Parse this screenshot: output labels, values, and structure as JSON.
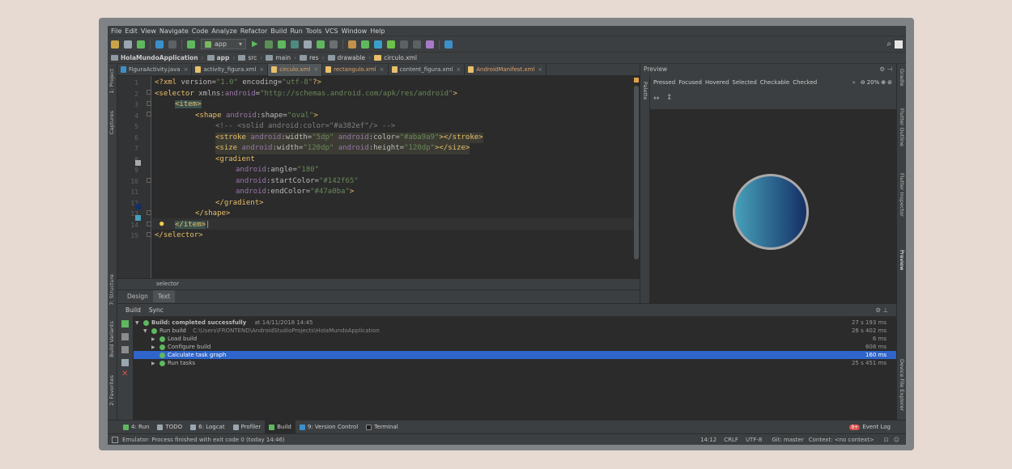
{
  "menu": [
    "File",
    "Edit",
    "View",
    "Navigate",
    "Code",
    "Analyze",
    "Refactor",
    "Build",
    "Run",
    "Tools",
    "VCS",
    "Window",
    "Help"
  ],
  "toolbar": {
    "run_config": "app"
  },
  "breadcrumbs": [
    "HolaMundoApplication",
    "app",
    "src",
    "main",
    "res",
    "drawable",
    "circulo.xml"
  ],
  "tabs": [
    "FiguraActivity.java",
    "activity_figura.xml",
    "circulo.xml",
    "rectangulo.xml",
    "content_figura.xml",
    "AndroidManifest.xml"
  ],
  "editor": {
    "line_numbers": [
      "1",
      "2",
      "3",
      "4",
      "5",
      "6",
      "7",
      "8",
      "9",
      "10",
      "11",
      "12",
      "13",
      "14",
      "15"
    ],
    "breadcrumb": "selector",
    "swatches": {
      "stroke": "#aba9a9",
      "start": "#142f65",
      "end": "#47a0ba"
    }
  },
  "design_tabs": [
    "Design",
    "Text"
  ],
  "left_strip": [
    "1: Project",
    "Captures",
    "7: Structure",
    "Build Variants",
    "2: Favorites"
  ],
  "right_strip": [
    "Gradle",
    "Flutter Outline",
    "Flutter Inspector",
    "Preview",
    "Device File Explorer"
  ],
  "preview": {
    "title": "Preview",
    "palette": "Palette",
    "states": [
      "Pressed",
      "Focused",
      "Hovered",
      "Selected",
      "Checkable",
      "Checked"
    ],
    "zoom": "20%"
  },
  "build": {
    "tabs": [
      "Build",
      "Sync"
    ],
    "rows": [
      {
        "label": "Build: completed successfully",
        "extra": "at 14/11/2018 14:45",
        "time": "27 s 193 ms"
      },
      {
        "label": "Run build",
        "extra": "C:\\Users\\FRONTEND\\AndroidStudioProjects\\HolaMundoApplication",
        "time": "26 s 402 ms"
      },
      {
        "label": "Load build",
        "extra": "",
        "time": "6 ms"
      },
      {
        "label": "Configure build",
        "extra": "",
        "time": "608 ms"
      },
      {
        "label": "Calculate task graph",
        "extra": "",
        "time": "160 ms"
      },
      {
        "label": "Run tasks",
        "extra": "",
        "time": "25 s 451 ms"
      }
    ]
  },
  "tool_tabs": [
    "4: Run",
    "TODO",
    "6: Logcat",
    "Profiler",
    "Build",
    "9: Version Control",
    "Terminal"
  ],
  "event_log": {
    "label": "Event Log",
    "count": "9+"
  },
  "status": {
    "message": "Emulator: Process finished with exit code 0 (today 14:46)",
    "position": "14:12",
    "line_sep": "CRLF",
    "encoding": "UTF-8",
    "git": "Git: master",
    "context": "Context: <no context>"
  }
}
